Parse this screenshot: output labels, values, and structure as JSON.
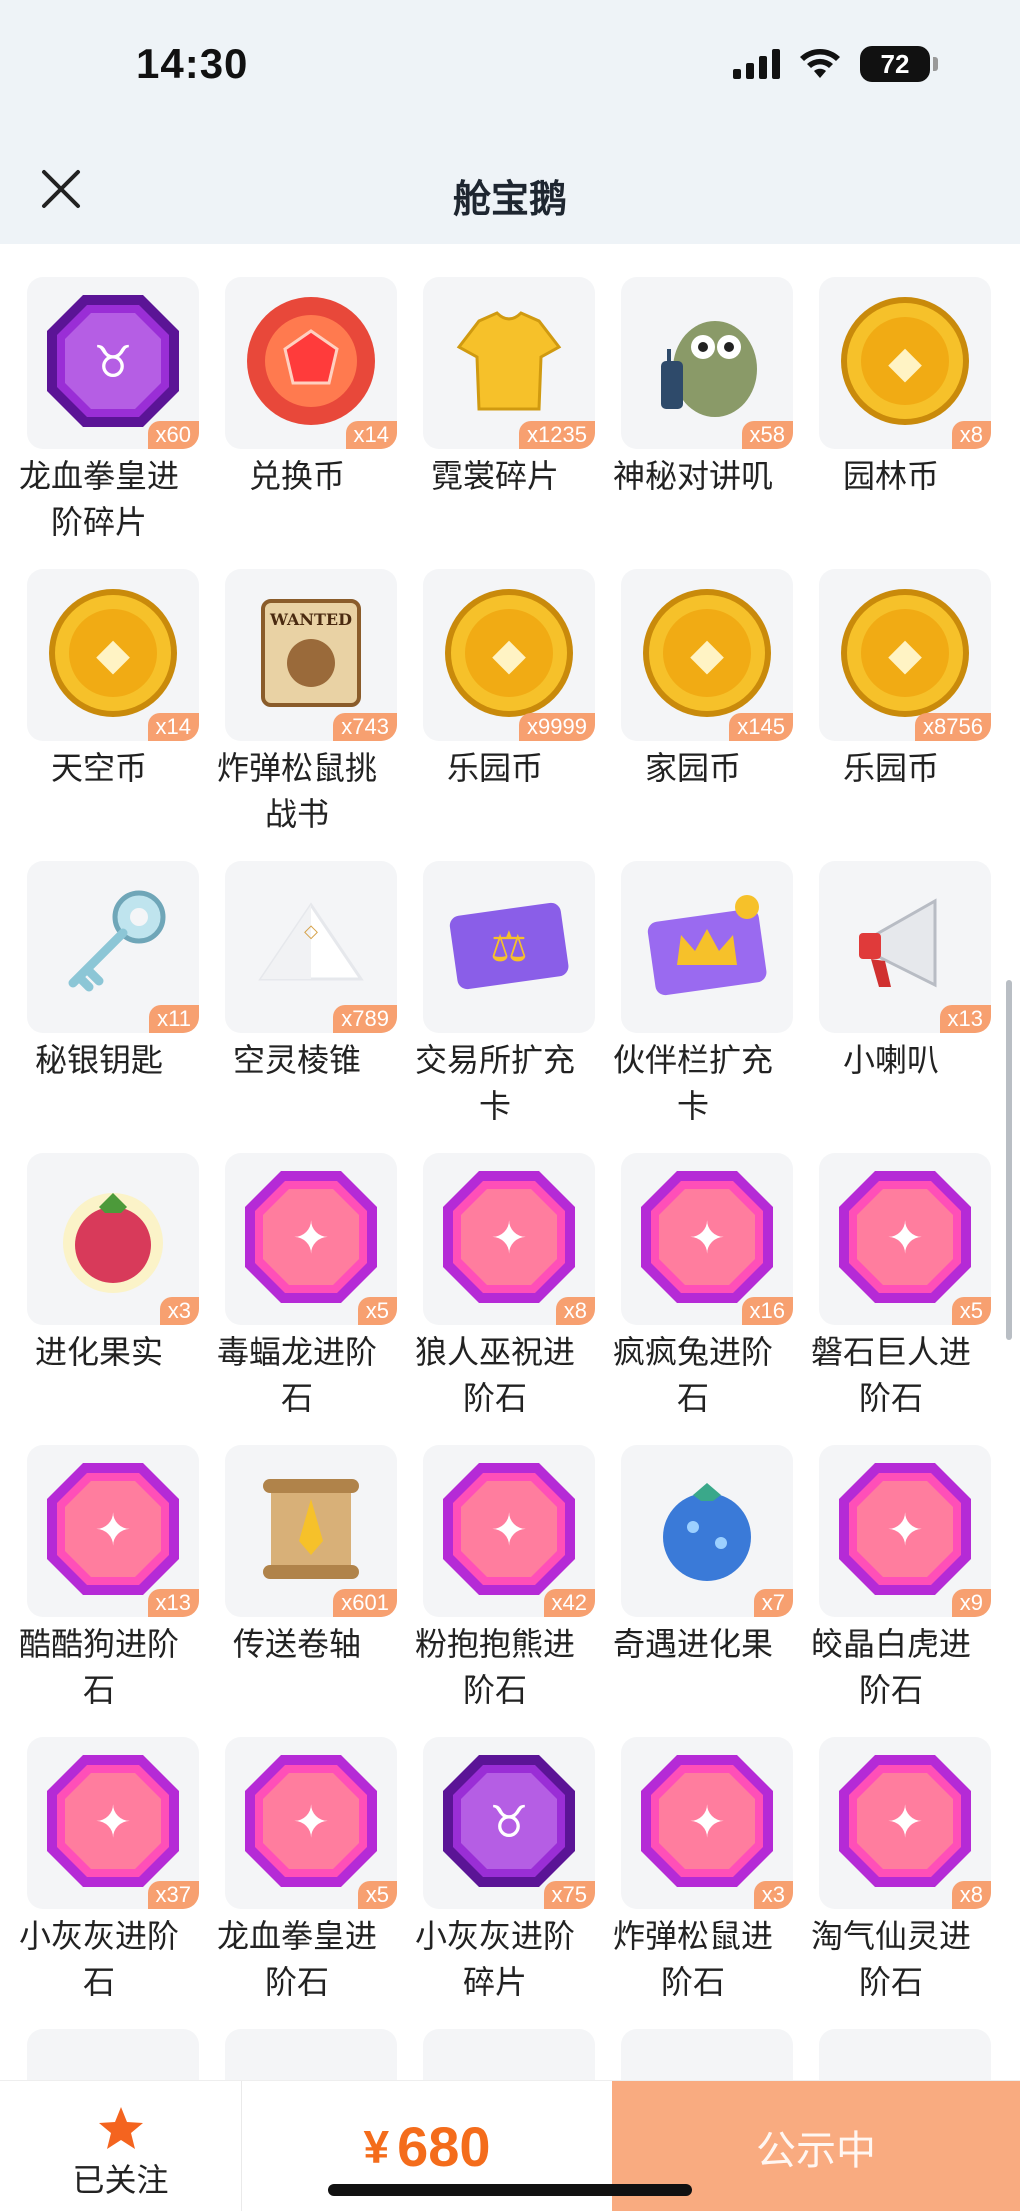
{
  "status_bar": {
    "time": "14:30",
    "battery": "72"
  },
  "header": {
    "title": "舱宝鹅",
    "close_icon": "close-icon"
  },
  "colors": {
    "price": "#f46c1b",
    "action_bg": "#f9ab80",
    "qty_badge": "#f7a070",
    "tile_bg": "#f4f5f7"
  },
  "items": [
    {
      "name": "龙血拳皇进阶碎片",
      "qty": "x60",
      "icon": "purple-bull-gem-icon"
    },
    {
      "name": "兑换币",
      "qty": "x14",
      "icon": "red-gem-coin-icon"
    },
    {
      "name": "霓裳碎片",
      "qty": "x1235",
      "icon": "gold-shirt-icon"
    },
    {
      "name": "神秘对讲叽",
      "qty": "x58",
      "icon": "walkie-talkie-bird-icon"
    },
    {
      "name": "园林币",
      "qty": "x8",
      "icon": "gold-garden-coin-icon"
    },
    {
      "name": "天空币",
      "qty": "x14",
      "icon": "gold-bow-coin-icon"
    },
    {
      "name": "炸弹松鼠挑战书",
      "qty": "x743",
      "icon": "wanted-scroll-icon"
    },
    {
      "name": "乐园币",
      "qty": "x9999",
      "icon": "gold-chest-coin-icon"
    },
    {
      "name": "家园币",
      "qty": "x145",
      "icon": "gold-home-coin-icon"
    },
    {
      "name": "乐园币",
      "qty": "x8756",
      "icon": "gold-chest-coin-icon"
    },
    {
      "name": "秘银钥匙",
      "qty": "x11",
      "icon": "silver-key-icon"
    },
    {
      "name": "空灵棱锥",
      "qty": "x789",
      "icon": "white-pyramid-icon"
    },
    {
      "name": "交易所扩充卡",
      "qty": "",
      "icon": "scale-card-icon"
    },
    {
      "name": "伙伴栏扩充卡",
      "qty": "",
      "icon": "crown-card-icon"
    },
    {
      "name": "小喇叭",
      "qty": "x13",
      "icon": "megaphone-icon"
    },
    {
      "name": "进化果实",
      "qty": "x3",
      "icon": "red-berry-fruit-icon"
    },
    {
      "name": "毒蝠龙进阶石",
      "qty": "x5",
      "icon": "pink-bat-gem-icon"
    },
    {
      "name": "狼人巫祝进阶石",
      "qty": "x8",
      "icon": "pink-mask-gem-icon"
    },
    {
      "name": "疯疯兔进阶石",
      "qty": "x16",
      "icon": "pink-carrot-gem-icon"
    },
    {
      "name": "磐石巨人进阶石",
      "qty": "x5",
      "icon": "pink-rock-gem-icon"
    },
    {
      "name": "酷酷狗进阶石",
      "qty": "x13",
      "icon": "pink-goggles-gem-icon"
    },
    {
      "name": "传送卷轴",
      "qty": "x601",
      "icon": "teleport-scroll-icon"
    },
    {
      "name": "粉抱抱熊进阶石",
      "qty": "x42",
      "icon": "pink-egg-gem-icon"
    },
    {
      "name": "奇遇进化果",
      "qty": "x7",
      "icon": "blue-berry-fruit-icon"
    },
    {
      "name": "皎晶白虎进阶石",
      "qty": "x9",
      "icon": "pink-claw-gem-icon"
    },
    {
      "name": "小灰灰进阶石",
      "qty": "x37",
      "icon": "pink-lollipop-gem-icon"
    },
    {
      "name": "龙血拳皇进阶石",
      "qty": "x5",
      "icon": "pink-bull-gem-icon"
    },
    {
      "name": "小灰灰进阶碎片",
      "qty": "x75",
      "icon": "purple-lollipop-gem-icon"
    },
    {
      "name": "炸弹松鼠进阶石",
      "qty": "x3",
      "icon": "pink-acorn-gem-icon"
    },
    {
      "name": "淘气仙灵进阶石",
      "qty": "x8",
      "icon": "pink-fairy-gem-icon"
    }
  ],
  "bottom_bar": {
    "follow_label": "已关注",
    "follow_icon": "star-icon",
    "currency": "¥",
    "price": "680",
    "status_button": "公示中"
  }
}
